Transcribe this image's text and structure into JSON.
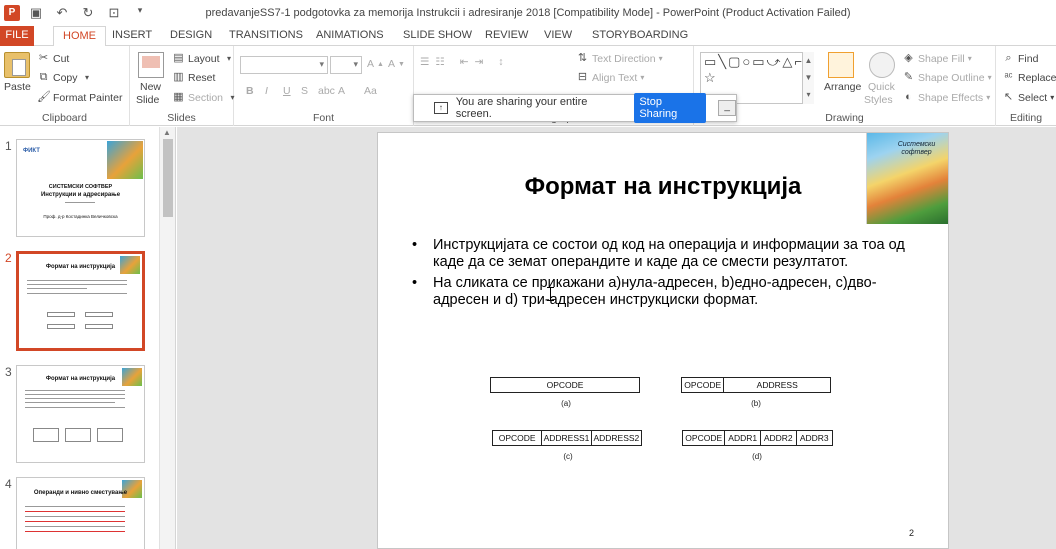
{
  "window": {
    "app_icon": "P",
    "title": "predavanjeSS7-1  podgotovka za memorija Instrukcii i adresiranje 2018 [Compatibility Mode] - PowerPoint (Product Activation Failed)",
    "quick_access_icons": [
      "save-icon",
      "undo-icon",
      "redo-icon",
      "present-icon",
      "customize-icon"
    ]
  },
  "tabs": [
    "FILE",
    "HOME",
    "INSERT",
    "DESIGN",
    "TRANSITIONS",
    "ANIMATIONS",
    "SLIDE SHOW",
    "REVIEW",
    "VIEW",
    "STORYBOARDING"
  ],
  "active_tab": "HOME",
  "ribbon": {
    "clipboard": {
      "label": "Clipboard",
      "paste": "Paste",
      "cut": "Cut",
      "copy": "Copy",
      "format_painter": "Format Painter"
    },
    "slides": {
      "label": "Slides",
      "new_slide_1": "New",
      "new_slide_2": "Slide",
      "layout": "Layout",
      "reset": "Reset",
      "section": "Section"
    },
    "font": {
      "label": "Font",
      "bold": "B",
      "italic": "I",
      "underline": "U",
      "strike": "S",
      "char_spacing": "abc",
      "font_color": "A",
      "change_case": "Aa",
      "grow": "A",
      "shrink": "A"
    },
    "paragraph": {
      "label": "Paragraph",
      "text_direction": "Text Direction",
      "align_text": "Align Text"
    },
    "drawing": {
      "label": "Drawing",
      "arrange": "Arrange",
      "quick_styles_1": "Quick",
      "quick_styles_2": "Styles",
      "shape_fill": "Shape Fill",
      "shape_outline": "Shape Outline",
      "shape_effects": "Shape Effects",
      "shapes_glyphs": "▭╲▢○▭⤻△⌐⇨⇩◯╮⌢{}☆"
    },
    "editing": {
      "label": "Editing",
      "find": "Find",
      "replace": "Replace",
      "select": "Select"
    }
  },
  "share_banner": {
    "message": "You are sharing your entire screen.",
    "stop_button": "Stop Sharing",
    "minimize": "_"
  },
  "thumbnails": [
    {
      "number": "1",
      "logo": "ФИКТ",
      "line1": "СИСТЕМСКИ СОФТВЕР",
      "line2": "Инструкции и адресирање",
      "line3": "Проф. д-р Костадинка Величковска"
    },
    {
      "number": "2",
      "title": "Формат на инструкција"
    },
    {
      "number": "3",
      "title": "Формат на инструкција"
    },
    {
      "number": "4",
      "title": "Операнди и нивно сместување"
    }
  ],
  "slide": {
    "title": "Формат на инструкција",
    "image_label": "Системски софтвер",
    "bullets": [
      "Инструкцијата се состои од код на операција и информации за тоа од каде да се земат операндите и каде да се смести резултатот.",
      "На сликата се прикажани а)нула-адресен, b)едно-адресен, c)дво-адресен и d) три-адресен инструкциски формат."
    ],
    "formats": {
      "a": {
        "cells": [
          "OPCODE"
        ],
        "caption": "(a)"
      },
      "b": {
        "cells": [
          "OPCODE",
          "ADDRESS"
        ],
        "caption": "(b)"
      },
      "c": {
        "cells": [
          "OPCODE",
          "ADDRESS1",
          "ADDRESS2"
        ],
        "caption": "(c)"
      },
      "d": {
        "cells": [
          "OPCODE",
          "ADDR1",
          "ADDR2",
          "ADDR3"
        ],
        "caption": "(d)"
      }
    },
    "page_number": "2"
  },
  "colors": {
    "accent": "#d24726",
    "share_button": "#1a73e8",
    "stage_bg": "#e3e3e3"
  }
}
